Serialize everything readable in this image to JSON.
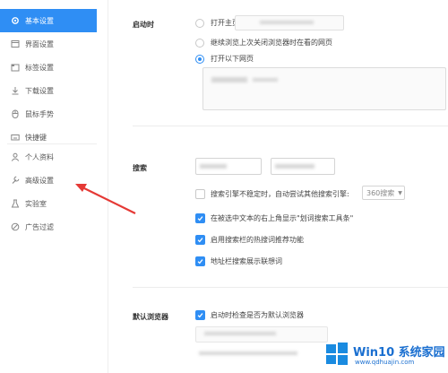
{
  "sidebar": {
    "items": [
      {
        "label": "基本设置",
        "icon": "gear-icon",
        "active": true
      },
      {
        "label": "界面设置",
        "icon": "window-icon",
        "active": false
      },
      {
        "label": "标签设置",
        "icon": "tab-icon",
        "active": false
      },
      {
        "label": "下载设置",
        "icon": "download-icon",
        "active": false
      },
      {
        "label": "鼠标手势",
        "icon": "mouse-icon",
        "active": false
      },
      {
        "label": "快捷键",
        "icon": "keyboard-icon",
        "active": false
      },
      {
        "label": "个人资料",
        "icon": "person-icon",
        "active": false
      },
      {
        "label": "高级设置",
        "icon": "wrench-icon",
        "active": false
      },
      {
        "label": "实验室",
        "icon": "flask-icon",
        "active": false
      },
      {
        "label": "广告过滤",
        "icon": "block-icon",
        "active": false
      }
    ]
  },
  "startup": {
    "label": "启动时",
    "option_home": "打开主页",
    "option_restore": "继续浏览上次关闭浏览器时在看的网页",
    "option_pages": "打开以下网页"
  },
  "search": {
    "label": "搜索",
    "fallback_text": "搜索引擎不稳定时，自动尝试其他搜索引擎:",
    "fallback_select": "360搜索",
    "option_selection": "在被选中文本的右上角显示\"划词搜索工具条\"",
    "option_hotwords": "启用搜索栏的热搜词推荐功能",
    "option_suggest": "地址栏搜索展示联想词"
  },
  "default_browser": {
    "label": "默认浏览器",
    "option_check": "启动时检查是否为默认浏览器"
  },
  "watermark": {
    "title": "Win10 系统家园",
    "url": "www.qdhuajin.com"
  },
  "colors": {
    "accent": "#2f8ef4",
    "arrow": "#e53935"
  }
}
